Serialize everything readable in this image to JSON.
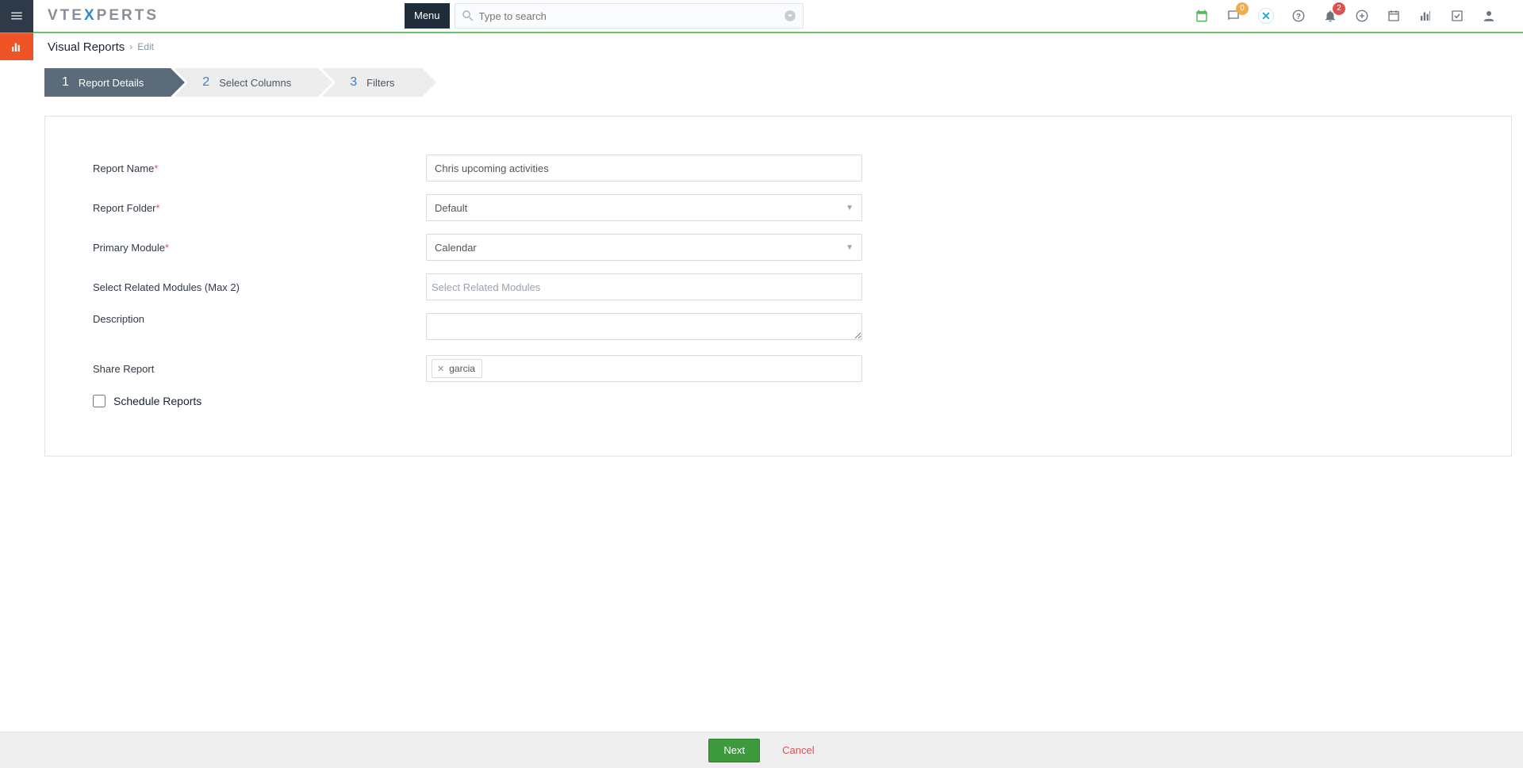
{
  "header": {
    "logo_text_plain": "VTE",
    "logo_text_accent": "X",
    "logo_text_tail": "PERTS",
    "menu_label": "Menu",
    "search_placeholder": "Type to search",
    "chat_badge": "0",
    "bell_badge": "2"
  },
  "breadcrumb": {
    "module": "Visual Reports",
    "leaf": "Edit"
  },
  "steps": [
    {
      "num": "1",
      "label": "Report Details",
      "active": true
    },
    {
      "num": "2",
      "label": "Select Columns",
      "active": false
    },
    {
      "num": "3",
      "label": "Filters",
      "active": false
    }
  ],
  "form": {
    "report_name_label": "Report Name",
    "report_name_value": "Chris upcoming activities",
    "report_folder_label": "Report Folder",
    "report_folder_value": "Default",
    "primary_module_label": "Primary Module",
    "primary_module_value": "Calendar",
    "related_modules_label": "Select Related Modules (Max 2)",
    "related_modules_placeholder": "Select Related Modules",
    "description_label": "Description",
    "description_value": "",
    "share_report_label": "Share Report",
    "share_chips": [
      {
        "label": "garcia"
      }
    ],
    "schedule_label": "Schedule Reports"
  },
  "footer": {
    "next": "Next",
    "cancel": "Cancel"
  }
}
